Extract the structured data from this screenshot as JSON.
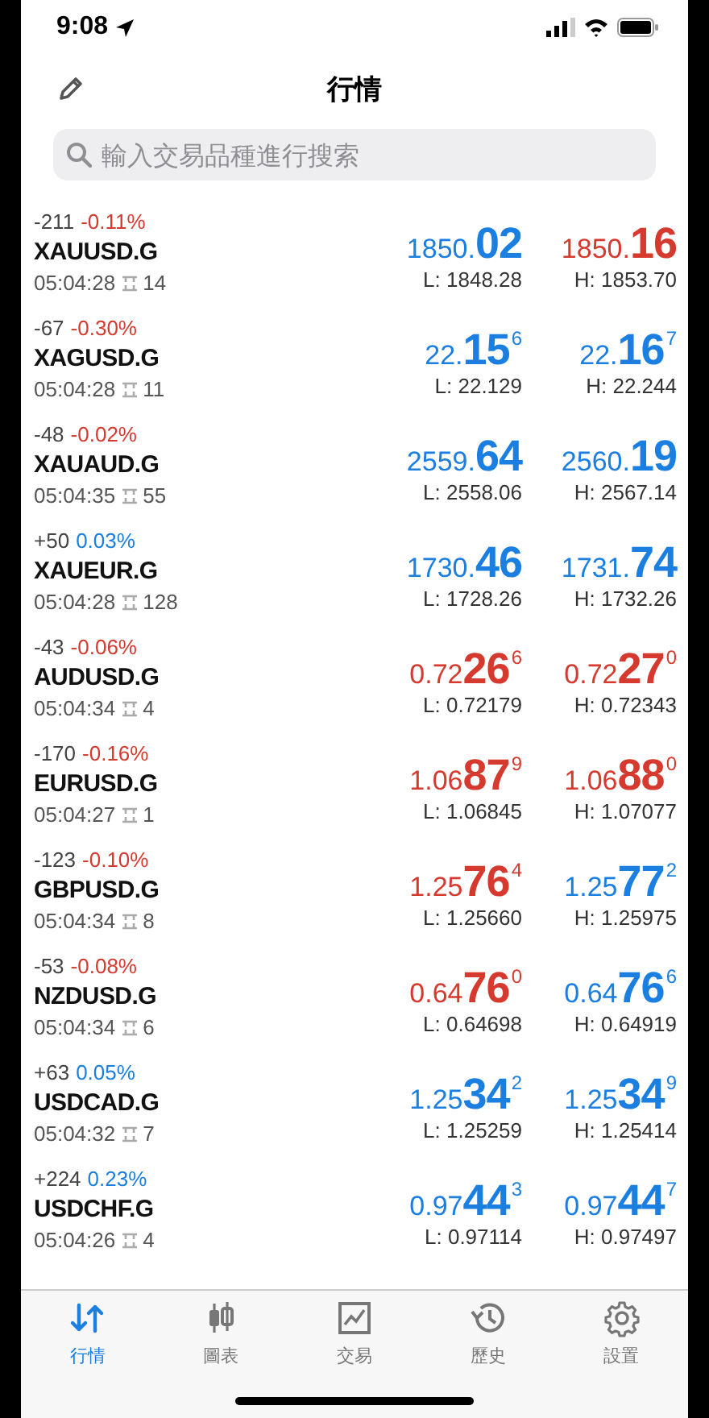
{
  "status_bar": {
    "time": "9:08"
  },
  "nav": {
    "title": "行情"
  },
  "search": {
    "placeholder": "輸入交易品種進行搜索"
  },
  "quotes": [
    {
      "points": "-211",
      "change": "-0.11%",
      "change_rising": false,
      "symbol": "XAUUSD.G",
      "time": "05:04:28",
      "spread": "14",
      "bid": {
        "prefix": "1850.",
        "big": "02",
        "rising": true
      },
      "ask": {
        "prefix": "1850.",
        "big": "16",
        "rising": false
      },
      "low": "L: 1848.28",
      "high": "H: 1853.70"
    },
    {
      "points": "-67",
      "change": "-0.30%",
      "change_rising": false,
      "symbol": "XAGUSD.G",
      "time": "05:04:28",
      "spread": "11",
      "bid": {
        "prefix": "22.",
        "big": "15",
        "sup": "6",
        "rising": true
      },
      "ask": {
        "prefix": "22.",
        "big": "16",
        "sup": "7",
        "rising": true
      },
      "low": "L: 22.129",
      "high": "H: 22.244"
    },
    {
      "points": "-48",
      "change": "-0.02%",
      "change_rising": false,
      "symbol": "XAUAUD.G",
      "time": "05:04:35",
      "spread": "55",
      "bid": {
        "prefix": "2559.",
        "big": "64",
        "rising": true
      },
      "ask": {
        "prefix": "2560.",
        "big": "19",
        "rising": true
      },
      "low": "L: 2558.06",
      "high": "H: 2567.14"
    },
    {
      "points": "+50",
      "change": "0.03%",
      "change_rising": true,
      "symbol": "XAUEUR.G",
      "time": "05:04:28",
      "spread": "128",
      "bid": {
        "prefix": "1730.",
        "big": "46",
        "rising": true
      },
      "ask": {
        "prefix": "1731.",
        "big": "74",
        "rising": true
      },
      "low": "L: 1728.26",
      "high": "H: 1732.26"
    },
    {
      "points": "-43",
      "change": "-0.06%",
      "change_rising": false,
      "symbol": "AUDUSD.G",
      "time": "05:04:34",
      "spread": "4",
      "bid": {
        "prefix": "0.72",
        "big": "26",
        "sup": "6",
        "rising": false
      },
      "ask": {
        "prefix": "0.72",
        "big": "27",
        "sup": "0",
        "rising": false
      },
      "low": "L: 0.72179",
      "high": "H: 0.72343"
    },
    {
      "points": "-170",
      "change": "-0.16%",
      "change_rising": false,
      "symbol": "EURUSD.G",
      "time": "05:04:27",
      "spread": "1",
      "bid": {
        "prefix": "1.06",
        "big": "87",
        "sup": "9",
        "rising": false
      },
      "ask": {
        "prefix": "1.06",
        "big": "88",
        "sup": "0",
        "rising": false
      },
      "low": "L: 1.06845",
      "high": "H: 1.07077"
    },
    {
      "points": "-123",
      "change": "-0.10%",
      "change_rising": false,
      "symbol": "GBPUSD.G",
      "time": "05:04:34",
      "spread": "8",
      "bid": {
        "prefix": "1.25",
        "big": "76",
        "sup": "4",
        "rising": false
      },
      "ask": {
        "prefix": "1.25",
        "big": "77",
        "sup": "2",
        "rising": true
      },
      "low": "L: 1.25660",
      "high": "H: 1.25975"
    },
    {
      "points": "-53",
      "change": "-0.08%",
      "change_rising": false,
      "symbol": "NZDUSD.G",
      "time": "05:04:34",
      "spread": "6",
      "bid": {
        "prefix": "0.64",
        "big": "76",
        "sup": "0",
        "rising": false
      },
      "ask": {
        "prefix": "0.64",
        "big": "76",
        "sup": "6",
        "rising": true
      },
      "low": "L: 0.64698",
      "high": "H: 0.64919"
    },
    {
      "points": "+63",
      "change": "0.05%",
      "change_rising": true,
      "symbol": "USDCAD.G",
      "time": "05:04:32",
      "spread": "7",
      "bid": {
        "prefix": "1.25",
        "big": "34",
        "sup": "2",
        "rising": true
      },
      "ask": {
        "prefix": "1.25",
        "big": "34",
        "sup": "9",
        "rising": true
      },
      "low": "L: 1.25259",
      "high": "H: 1.25414"
    },
    {
      "points": "+224",
      "change": "0.23%",
      "change_rising": true,
      "symbol": "USDCHF.G",
      "time": "05:04:26",
      "spread": "4",
      "bid": {
        "prefix": "0.97",
        "big": "44",
        "sup": "3",
        "rising": true
      },
      "ask": {
        "prefix": "0.97",
        "big": "44",
        "sup": "7",
        "rising": true
      },
      "low": "L: 0.97114",
      "high": "H: 0.97497"
    }
  ],
  "tab_bar": [
    {
      "kind": "quotes",
      "label": "行情",
      "selected": true
    },
    {
      "kind": "chart",
      "label": "圖表",
      "selected": false
    },
    {
      "kind": "trade",
      "label": "交易",
      "selected": false
    },
    {
      "kind": "history",
      "label": "歷史",
      "selected": false
    },
    {
      "kind": "settings",
      "label": "設置",
      "selected": false
    }
  ]
}
